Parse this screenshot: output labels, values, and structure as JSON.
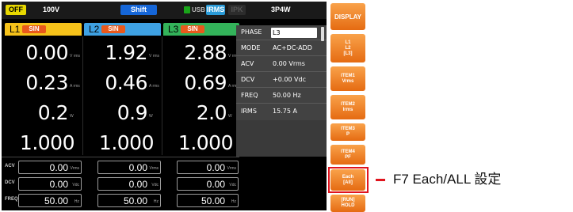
{
  "status_bar": {
    "output": "OFF",
    "voltage_range": "100V",
    "shift": "Shift",
    "usb": "USB",
    "irms": "IRMS",
    "ipk": "IPK",
    "wiring": "3P4W"
  },
  "channels": [
    {
      "label": "L1",
      "waveform": "SIN",
      "color": "#f6c21a",
      "voltage": "0.00",
      "voltage_unit": "V rms",
      "current": "0.23",
      "current_unit": "A rms",
      "power": "0.2",
      "power_unit": "W",
      "pf": "1.000",
      "acv": "0.00",
      "acv_unit": "Vrms",
      "dcv": "0.00",
      "dcv_unit": "Vdc",
      "freq": "50.00",
      "freq_unit": "Hz"
    },
    {
      "label": "L2",
      "waveform": "SIN",
      "color": "#3ea1e2",
      "voltage": "1.92",
      "voltage_unit": "V rms",
      "current": "0.46",
      "current_unit": "A rms",
      "power": "0.9",
      "power_unit": "W",
      "pf": "1.000",
      "acv": "0.00",
      "acv_unit": "Vrms",
      "dcv": "0.00",
      "dcv_unit": "Vdc",
      "freq": "50.00",
      "freq_unit": "Hz"
    },
    {
      "label": "L3",
      "waveform": "SIN",
      "color": "#33b35a",
      "voltage": "2.88",
      "voltage_unit": "V rms",
      "current": "0.69",
      "current_unit": "A rms",
      "power": "2.0",
      "power_unit": "W",
      "pf": "1.000",
      "acv": "0.00",
      "acv_unit": "Vrms",
      "dcv": "0.00",
      "dcv_unit": "Vdc",
      "freq": "50.00",
      "freq_unit": "Hz"
    }
  ],
  "row_labels": {
    "acv": "ACV",
    "dcv": "DCV",
    "freq": "FREQ"
  },
  "params": [
    {
      "key": "PHASE",
      "value": "L3"
    },
    {
      "key": "MODE",
      "value": "AC+DC-ADD"
    },
    {
      "key": "ACV",
      "value": "0.00 Vrms"
    },
    {
      "key": "DCV",
      "value": "+0.00 Vdc"
    },
    {
      "key": "FREQ",
      "value": "50.00 Hz"
    },
    {
      "key": "IRMS",
      "value": "15.75 A"
    }
  ],
  "softkeys": [
    {
      "label": "DISPLAY"
    },
    {
      "label": "L1\nL2\n[L3]"
    },
    {
      "label": "ITEM1\nVrms"
    },
    {
      "label": "ITEM2\nIrms"
    },
    {
      "label": "ITEM3\nP"
    },
    {
      "label": "ITEM4\nPF"
    },
    {
      "label": "Each\n[All]"
    },
    {
      "label": "[RUN]\nHOLD"
    }
  ],
  "annotation": "F7 Each/ALL 設定",
  "colors": {
    "highlight": "#e0141d",
    "softkey": "#f08a2e",
    "panel": "#424242"
  }
}
